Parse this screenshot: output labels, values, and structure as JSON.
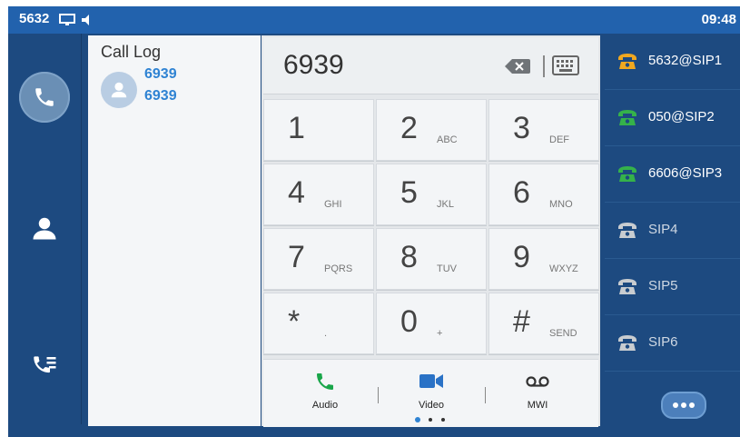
{
  "status_bar": {
    "extension": "5632",
    "time": "09:48"
  },
  "left_nav": {
    "items": [
      "dialer",
      "contacts",
      "call-history"
    ]
  },
  "call_log": {
    "title": "Call Log",
    "entries": [
      {
        "name": "6939",
        "number": "6939"
      }
    ]
  },
  "dialer": {
    "input_value": "6939",
    "keys": [
      {
        "digit": "1",
        "letters": ""
      },
      {
        "digit": "2",
        "letters": "ABC"
      },
      {
        "digit": "3",
        "letters": "DEF"
      },
      {
        "digit": "4",
        "letters": "GHI"
      },
      {
        "digit": "5",
        "letters": "JKL"
      },
      {
        "digit": "6",
        "letters": "MNO"
      },
      {
        "digit": "7",
        "letters": "PQRS"
      },
      {
        "digit": "8",
        "letters": "TUV"
      },
      {
        "digit": "9",
        "letters": "WXYZ"
      },
      {
        "digit": "*",
        "letters": "."
      },
      {
        "digit": "0",
        "letters": "+"
      },
      {
        "digit": "#",
        "letters": "SEND"
      }
    ],
    "actions": {
      "audio": "Audio",
      "video": "Video",
      "mwi": "MWI"
    },
    "page_index": 1,
    "page_count": 3
  },
  "lines": [
    {
      "name": "5632@SIP1",
      "status_color": "#f0a820"
    },
    {
      "name": "050@SIP2",
      "status_color": "#35b24a"
    },
    {
      "name": "6606@SIP3",
      "status_color": "#35b24a"
    },
    {
      "name": "SIP4",
      "status_color": "#c8ccd0"
    },
    {
      "name": "SIP5",
      "status_color": "#c8ccd0"
    },
    {
      "name": "SIP6",
      "status_color": "#c8ccd0"
    }
  ],
  "colors": {
    "accent": "#2262ad",
    "panel": "#1d4a80",
    "link": "#2f83d3",
    "call_green": "#19a64a"
  }
}
